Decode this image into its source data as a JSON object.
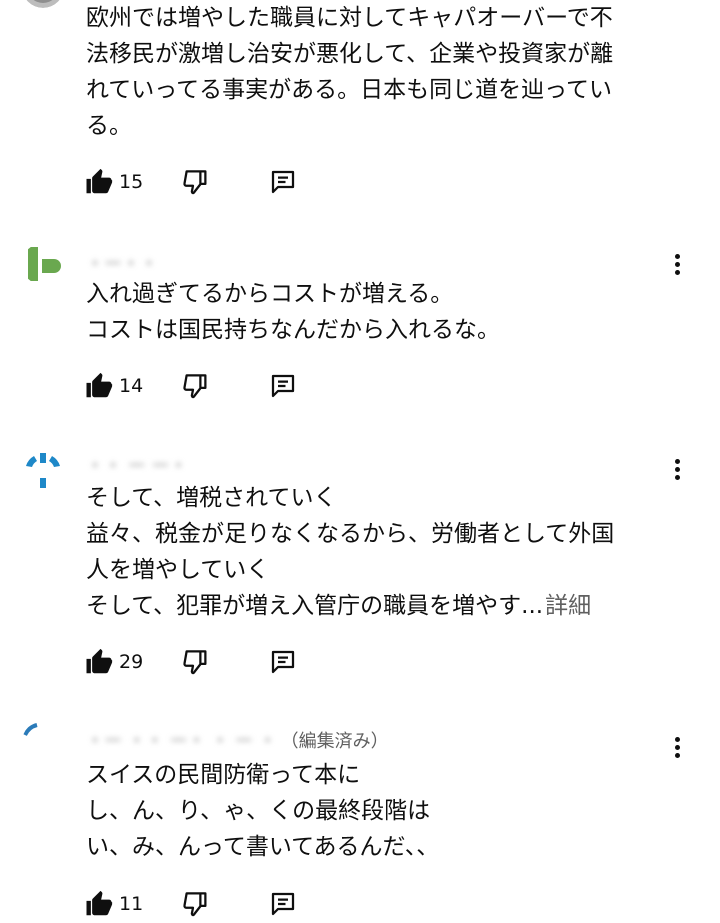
{
  "comments": [
    {
      "author": "",
      "lines": [
        "欧州では増やした職員に対してキャパオーバーで不",
        "法移民が激増し治安が悪化して、企業や投資家が離",
        "れていってる事実がある。日本も同じ道を辿ってい",
        "る。"
      ],
      "read_more": "",
      "likes": "15",
      "avatar_color": "#9e9e9e"
    },
    {
      "author": "",
      "lines": [
        "入れ過ぎてるからコストが増える。",
        "コストは国民持ちなんだから入れるな。"
      ],
      "read_more": "",
      "likes": "14",
      "avatar_color": "#6aa84f"
    },
    {
      "author": "",
      "lines": [
        "そして、増税されていく",
        "益々、税金が足りなくなるから、労働者として外国",
        "人を増やしていく",
        "そして、犯罪が増え入管庁の職員を増やす..."
      ],
      "read_more": "詳細",
      "likes": "29",
      "avatar_color": "#1e88c8"
    },
    {
      "author": "（編集済み）",
      "lines": [
        "スイスの民間防衛って本に",
        "し、ん、り、ゃ、くの最終段階は",
        "い、み、んって書いてあるんだ、、"
      ],
      "read_more": "",
      "likes": "11",
      "avatar_color": "#2b7bb9"
    }
  ],
  "icons": {
    "like": "thumbs-up-icon",
    "dislike": "thumbs-down-icon",
    "reply": "comment-icon",
    "more": "more-vert-icon"
  },
  "colors": {
    "text": "#0f0f0f",
    "secondary": "#606060"
  }
}
